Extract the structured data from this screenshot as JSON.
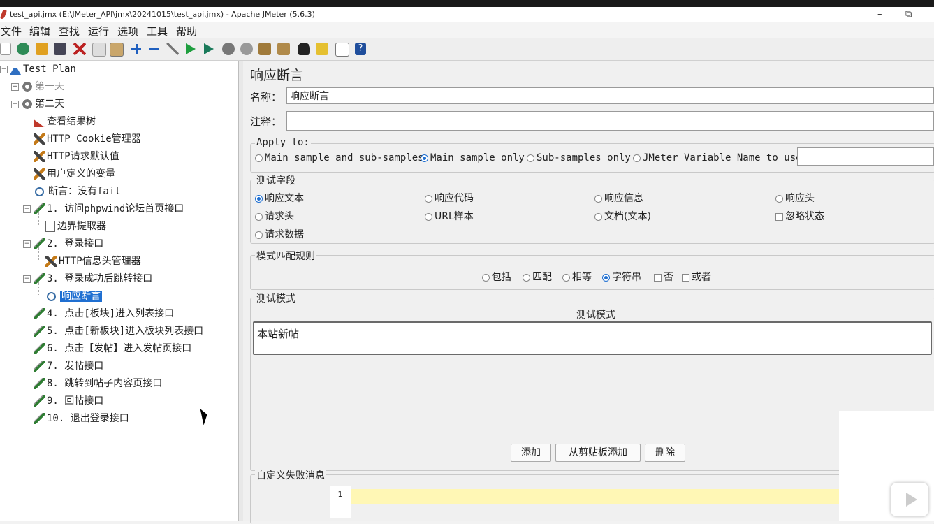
{
  "window": {
    "title": "test_api.jmx (E:\\JMeter_API\\jmx\\20241015\\test_api.jmx) - Apache JMeter (5.6.3)",
    "minimize": "–",
    "restore": "⧉"
  },
  "menu": [
    "文件",
    "编辑",
    "查找",
    "运行",
    "选项",
    "工具",
    "帮助"
  ],
  "toolbar": [
    "new-icon",
    "templates-icon",
    "open-icon",
    "save-icon",
    "cut-icon",
    "copy-icon",
    "paste-icon",
    "expand-icon",
    "collapse-icon",
    "toggle-icon",
    "start-icon",
    "start-no-pause-icon",
    "stop-icon",
    "shutdown-icon",
    "clear-icon",
    "clear-all-icon",
    "search-icon",
    "reset-search-icon",
    "function-helper-icon",
    "help-icon"
  ],
  "tree": [
    {
      "label": "Test Plan",
      "icon": "flask"
    },
    {
      "label": "第一天",
      "icon": "gear"
    },
    {
      "label": "第二天",
      "icon": "gear"
    },
    {
      "label": "查看结果树",
      "icon": "chart"
    },
    {
      "label": "HTTP Cookie管理器",
      "icon": "wrench"
    },
    {
      "label": "HTTP请求默认值",
      "icon": "wrench"
    },
    {
      "label": "用户定义的变量",
      "icon": "wrench"
    },
    {
      "label": "断言：没有fail",
      "icon": "mag"
    },
    {
      "label": "1. 访问phpwind论坛首页接口",
      "icon": "pipette"
    },
    {
      "label": "边界提取器",
      "icon": "extract"
    },
    {
      "label": "2. 登录接口",
      "icon": "pipette"
    },
    {
      "label": "HTTP信息头管理器",
      "icon": "wrench"
    },
    {
      "label": "3. 登录成功后跳转接口",
      "icon": "pipette"
    },
    {
      "label": "响应断言",
      "icon": "mag"
    },
    {
      "label": "4. 点击[板块]进入列表接口",
      "icon": "pipette"
    },
    {
      "label": "5. 点击[新板块]进入板块列表接口",
      "icon": "pipette"
    },
    {
      "label": "6. 点击【发帖】进入发帖页接口",
      "icon": "pipette"
    },
    {
      "label": "7. 发帖接口",
      "icon": "pipette"
    },
    {
      "label": "8. 跳转到帖子内容页接口",
      "icon": "pipette"
    },
    {
      "label": "9. 回帖接口",
      "icon": "pipette"
    },
    {
      "label": "10. 退出登录接口",
      "icon": "pipette"
    }
  ],
  "panel": {
    "title": "响应断言",
    "name_label": "名称：",
    "name_value": "响应断言",
    "comment_label": "注释：",
    "comment_value": "",
    "apply_to": {
      "title": "Apply to:",
      "options": [
        "Main sample and sub-samples",
        "Main sample only",
        "Sub-samples only",
        "JMeter Variable Name to use"
      ],
      "selected": "Main sample only",
      "variable_value": ""
    },
    "field": {
      "title": "测试字段",
      "options": [
        "响应文本",
        "响应代码",
        "响应信息",
        "响应头",
        "请求头",
        "URL样本",
        "文档(文本)",
        "忽略状态",
        "请求数据"
      ],
      "selected": "响应文本",
      "ignore_status": false
    },
    "rules": {
      "title": "模式匹配规则",
      "options": [
        "包括",
        "匹配",
        "相等",
        "字符串",
        "否",
        "或者"
      ],
      "selected": "字符串",
      "not": false,
      "or": false
    },
    "patterns": {
      "title": "测试模式",
      "column": "测试模式",
      "rows": [
        "本站新帖"
      ],
      "buttons": {
        "add": "添加",
        "add_clipboard": "从剪贴板添加",
        "delete": "删除"
      }
    },
    "failure": {
      "title": "自定义失败消息",
      "line_number": "1",
      "value": ""
    }
  }
}
